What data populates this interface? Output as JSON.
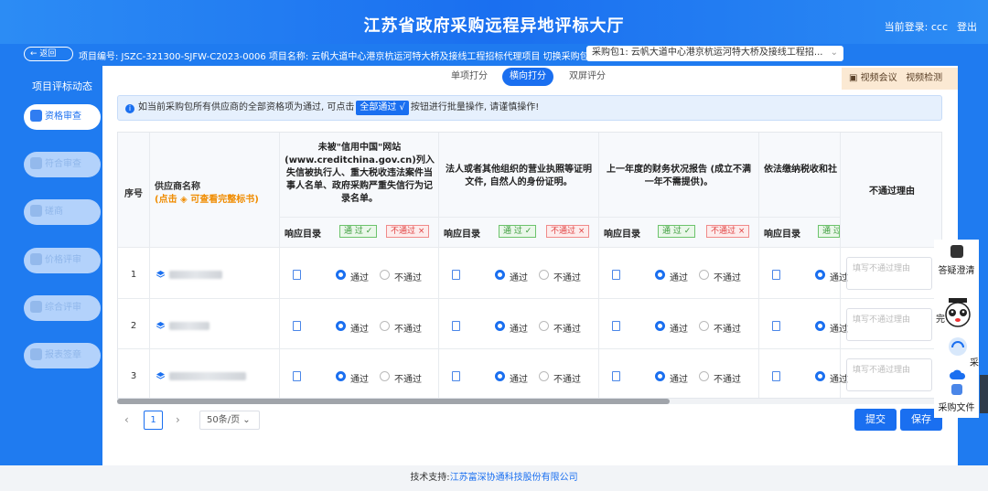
{
  "header": {
    "title": "江苏省政府采购远程异地评标大厅",
    "login_label": "当前登录: ccc",
    "logout": "登出"
  },
  "infobar": {
    "back": "返回",
    "project_text": "项目编号: JSZC-321300-SJFW-C2023-0006  项目名称: 云帆大道中心港京杭运河特大桥及接线工程招标代理项目  切换采购包:",
    "package_value": "采购包1: 云帆大道中心港京杭运河特大桥及接线工程招..."
  },
  "sidebar": {
    "title": "项目评标动态",
    "items": [
      {
        "label": "资格审查",
        "active": true
      },
      {
        "label": "符合审查",
        "active": false
      },
      {
        "label": "磋商",
        "active": false
      },
      {
        "label": "价格评审",
        "active": false
      },
      {
        "label": "综合评审",
        "active": false
      },
      {
        "label": "报表签章",
        "active": false
      }
    ]
  },
  "tabs": [
    {
      "label": "单项打分",
      "active": false
    },
    {
      "label": "横向打分",
      "active": true
    },
    {
      "label": "双屏评分",
      "active": false
    }
  ],
  "video": {
    "meeting": "视频会议",
    "detect": "视频检测"
  },
  "notice": {
    "before": "如当前采购包所有供应商的全部资格项为通过, 可点击",
    "button": "全部通过 √",
    "after": "按钮进行批量操作, 请谨慎操作!"
  },
  "table": {
    "col_seq": "序号",
    "col_supplier": "供应商名称",
    "supplier_hint": "(点击",
    "supplier_hint2": "可查看完整标书)",
    "criteria": [
      "未被\"信用中国\"网站(www.creditchina.gov.cn)列入失信被执行人、重大税收违法案件当事人名单、政府采购严重失信行为记录名单。",
      "法人或者其他组织的营业执照等证明文件, 自然人的身份证明。",
      "上一年度的财务状况报告 (成立不满一年不需提供)。",
      "依法缴纳税收和社会保障资金的相关材料"
    ],
    "col_reason": "不通过理由",
    "response_dir": "响应目录",
    "pass_tag": "通 过 ✓",
    "fail_tag": "不通过 ×",
    "pass": "通过",
    "fail": "不通过",
    "reason_placeholder": "填写不通过理由",
    "rows": [
      {
        "seq": "1"
      },
      {
        "seq": "2"
      },
      {
        "seq": "3"
      }
    ]
  },
  "pager": {
    "page": "1",
    "size": "50条/页"
  },
  "buttons": {
    "submit": "提交",
    "save": "保存"
  },
  "float_panel": {
    "qa": "答疑澄清",
    "done": "完",
    "collect": "采",
    "files": "采购文件"
  },
  "footer": {
    "label": "技术支持:",
    "company": "江苏富深协通科技股份有限公司"
  }
}
